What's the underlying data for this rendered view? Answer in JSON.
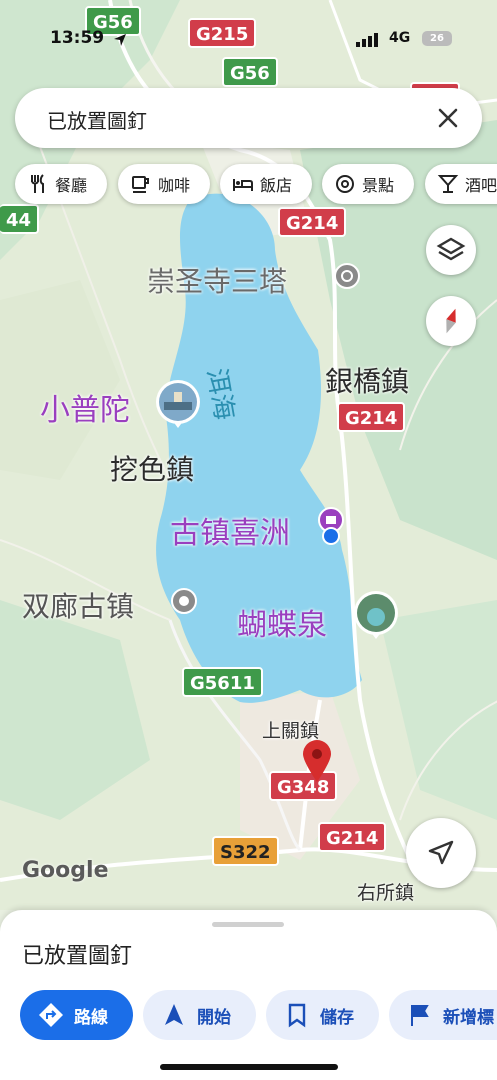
{
  "status_bar": {
    "time": "13:59",
    "network": "4G",
    "battery": "26"
  },
  "search": {
    "query": "已放置圖釘",
    "close_icon": "close-icon"
  },
  "categories": [
    {
      "label": "餐廳",
      "icon": "restaurant-icon"
    },
    {
      "label": "咖啡",
      "icon": "coffee-icon"
    },
    {
      "label": "飯店",
      "icon": "hotel-icon"
    },
    {
      "label": "景點",
      "icon": "attraction-icon"
    },
    {
      "label": "酒吧",
      "icon": "bar-icon"
    }
  ],
  "map": {
    "lake_name": "洱海",
    "road_badges": {
      "g56_top": "G56",
      "g215": "G215",
      "g56": "G56",
      "num44": "44",
      "g214_a": "G214",
      "g214_b": "G214",
      "g5611": "G5611",
      "g348": "G348",
      "g214_c": "G214",
      "s322": "S322"
    },
    "places": {
      "chongsheng": "崇圣寺三塔",
      "yinqiao": "銀橋鎮",
      "xiaoputuo": "小普陀",
      "wase": "挖色鎮",
      "guzhen": "古镇喜洲",
      "shuanglang": "双廊古镇",
      "hudiequan": "蝴蝶泉",
      "shangguan": "上關鎮",
      "yousuo": "右所鎮"
    },
    "attribution": "Google",
    "colors": {
      "water": "#8fd3ee",
      "pin": "#d62d2d",
      "poi": "#9a3fbf"
    }
  },
  "sheet": {
    "title": "已放置圖釘",
    "actions": [
      {
        "label": "路線",
        "icon": "directions-icon"
      },
      {
        "label": "開始",
        "icon": "navigation-icon"
      },
      {
        "label": "儲存",
        "icon": "bookmark-icon"
      },
      {
        "label": "新增標",
        "icon": "flag-icon"
      }
    ]
  }
}
